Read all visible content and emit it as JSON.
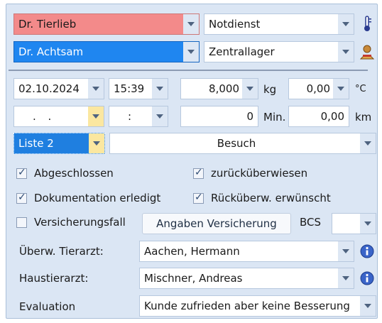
{
  "row1": {
    "vet": "Dr. Tierlieb",
    "service": "Notdienst"
  },
  "row2": {
    "vet": "Dr. Achtsam",
    "location": "Zentrallager"
  },
  "measure": {
    "date": "02.10.2024",
    "time": "15:39",
    "weight": "8,000",
    "weight_unit": "kg",
    "temperature": "0,00",
    "temp_unit": "°C",
    "date2": ". .",
    "time2": ":",
    "minutes": "0",
    "minutes_unit": "Min.",
    "distance": "0,00",
    "distance_unit": "km"
  },
  "list": {
    "value": "Liste 2",
    "type": "Besuch"
  },
  "checks": {
    "abgeschlossen": {
      "label": "Abgeschlossen",
      "checked": true
    },
    "zurueck": {
      "label": "zurücküberwiesen",
      "checked": true
    },
    "doku": {
      "label": "Dokumentation erledigt",
      "checked": true
    },
    "rueckwunsch": {
      "label": "Rücküberw. erwünscht",
      "checked": true
    },
    "versicherung": {
      "label": "Versicherungsfall",
      "checked": false
    }
  },
  "insurance_button": "Angaben Versicherung",
  "bcs": {
    "label": "BCS",
    "value": ""
  },
  "referring": {
    "label": "Überw. Tierarzt:",
    "value": "Aachen, Hermann"
  },
  "homevet": {
    "label": "Haustierarzt:",
    "value": "Mischner, Andreas"
  },
  "evaluation": {
    "label": "Evaluation",
    "value": "Kunde zufrieden aber keine Besserung"
  },
  "colors": {
    "vet1_bg": "#f38a8a",
    "vet2_bg": "#1f86f0",
    "list_bg": "#1f7fe0",
    "panel": "#dbe6f4"
  },
  "icons": [
    "thermometer-icon",
    "person-icon",
    "info-icon",
    "info-icon"
  ]
}
